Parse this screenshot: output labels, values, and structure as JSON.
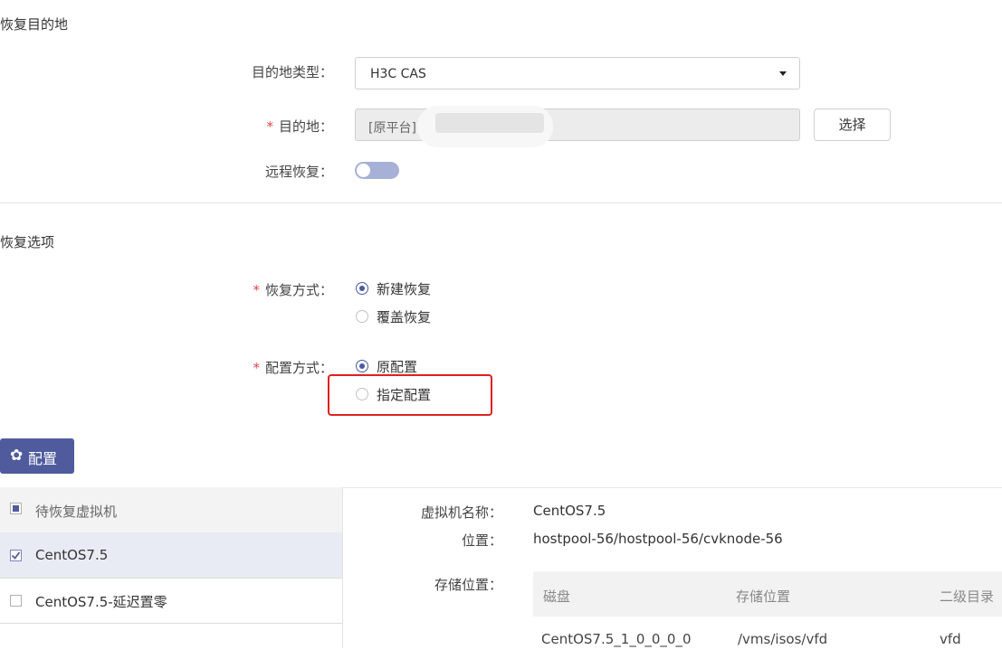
{
  "section1": {
    "title": "恢复目的地",
    "dest_type_label": "目的地类型：",
    "dest_type_value": "H3C CAS",
    "dest_label": "目的地：",
    "dest_value": "[原平台]",
    "choose_button": "选择",
    "remote_label": "远程恢复："
  },
  "section2": {
    "title": "恢复选项",
    "method_label": "恢复方式：",
    "method_options": [
      "新建恢复",
      "覆盖恢复"
    ],
    "config_label": "配置方式：",
    "config_options": [
      "原配置",
      "指定配置"
    ]
  },
  "config_button": "配置",
  "vm_list": {
    "header": "待恢复虚拟机",
    "items": [
      "CentOS7.5",
      "CentOS7.5-延迟置零"
    ]
  },
  "details": {
    "vm_name_label": "虚拟机名称：",
    "vm_name": "CentOS7.5",
    "location_label": "位置：",
    "location": "hostpool-56/hostpool-56/cvknode-56",
    "storage_label": "存储位置：",
    "table_headers": [
      "磁盘",
      "存储位置",
      "二级目录"
    ],
    "table_rows": [
      [
        "CentOS7.5_1_0_0_0_0",
        "/vms/isos/vfd",
        "vfd"
      ]
    ]
  },
  "colors": {
    "accent": "#505b9e",
    "required": "#e0484b",
    "highlight": "#e02020"
  }
}
